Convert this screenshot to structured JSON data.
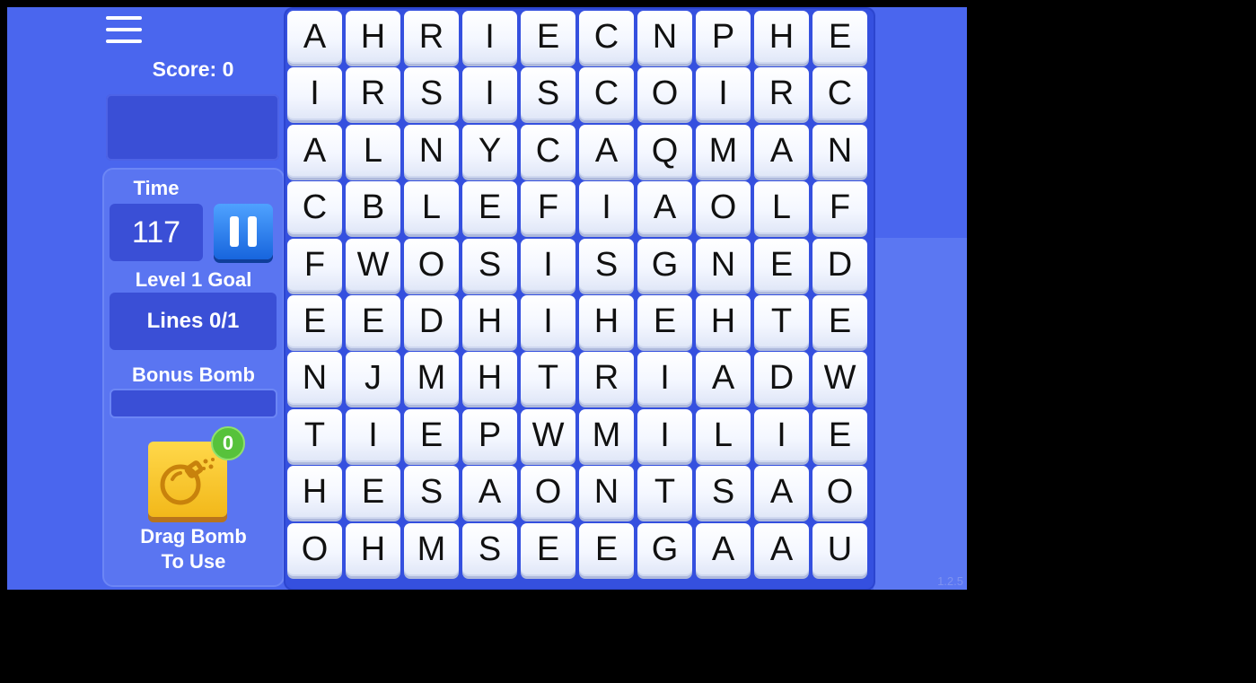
{
  "score_text": "Score: 0",
  "time": {
    "label": "Time",
    "value": "117"
  },
  "goal": {
    "label": "Level 1 Goal",
    "value": "Lines 0/1"
  },
  "bonus": {
    "label": "Bonus Bomb",
    "progress": 0
  },
  "bomb": {
    "count": "0",
    "hint_line1": "Drag Bomb",
    "hint_line2": "To Use"
  },
  "board": {
    "rows": [
      [
        "A",
        "H",
        "R",
        "I",
        "E",
        "C",
        "N",
        "P",
        "H",
        "E"
      ],
      [
        "I",
        "R",
        "S",
        "I",
        "S",
        "C",
        "O",
        "I",
        "R",
        "C"
      ],
      [
        "A",
        "L",
        "N",
        "Y",
        "C",
        "A",
        "Q",
        "M",
        "A",
        "N"
      ],
      [
        "C",
        "B",
        "L",
        "E",
        "F",
        "I",
        "A",
        "O",
        "L",
        "F"
      ],
      [
        "F",
        "W",
        "O",
        "S",
        "I",
        "S",
        "G",
        "N",
        "E",
        "D"
      ],
      [
        "E",
        "E",
        "D",
        "H",
        "I",
        "H",
        "E",
        "H",
        "T",
        "E"
      ],
      [
        "N",
        "J",
        "M",
        "H",
        "T",
        "R",
        "I",
        "A",
        "D",
        "W"
      ],
      [
        "T",
        "I",
        "E",
        "P",
        "W",
        "M",
        "I",
        "L",
        "I",
        "E"
      ],
      [
        "H",
        "E",
        "S",
        "A",
        "O",
        "N",
        "T",
        "S",
        "A",
        "O"
      ],
      [
        "O",
        "H",
        "M",
        "S",
        "E",
        "E",
        "G",
        "A",
        "A",
        "U"
      ]
    ]
  },
  "version": "1.2.5",
  "colors": {
    "background": "#4a66ee",
    "panel": "#5a75f1",
    "dark_box": "#3a4fd6",
    "pause_button": "#2f80f0",
    "bomb_tile": "#f7c531",
    "badge": "#57c23b"
  },
  "icons": {
    "menu": "hamburger-menu-icon",
    "pause": "pause-icon",
    "bomb": "bomb-icon"
  }
}
